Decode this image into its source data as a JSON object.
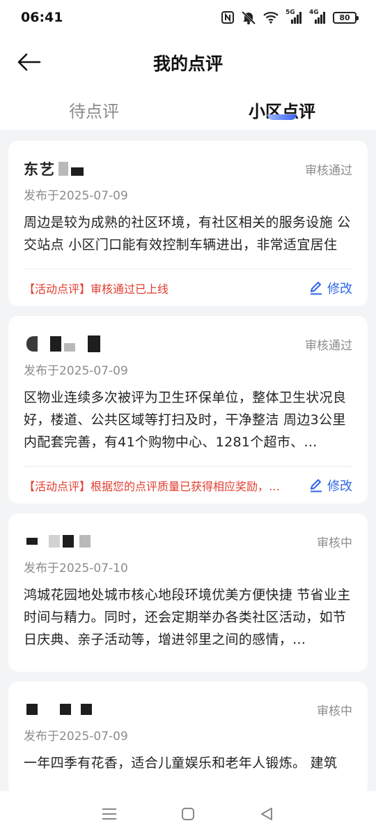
{
  "status_bar": {
    "time": "06:41",
    "battery": "80",
    "icons": [
      "nfc-icon",
      "mute-icon",
      "wifi-icon",
      "signal-5g-icon",
      "signal-4g-icon",
      "battery-icon"
    ],
    "signal_5g": "5G",
    "signal_4g": "4G"
  },
  "header": {
    "title": "我的点评",
    "back_icon": "back-arrow-icon"
  },
  "tabs": [
    {
      "label": "待点评",
      "active": false
    },
    {
      "label": "小区点评",
      "active": true
    }
  ],
  "colors": {
    "accent_blue": "#2f66e8",
    "alert_red": "#e03e2f",
    "muted_gray": "#8c8c8c"
  },
  "reviews": [
    {
      "author_visible": "东艺",
      "status": "审核通过",
      "date": "发布于2025-07-09",
      "content": "周边是较为成熟的社区环境，有社区相关的服务设施 公交站点 小区门口能有效控制车辆进出，非常适宜居住",
      "activity_note": "【活动点评】审核通过已上线",
      "edit_label": "修改"
    },
    {
      "author_visible": "",
      "status": "审核通过",
      "date": "发布于2025-07-09",
      "content": "区物业连续多次被评为卫生环保单位，整体卫生状况良好，楼道、公共区域等打扫及时，干净整洁 周边3公里内配套完善，有41个购物中心、1281个超市、…",
      "activity_note": "【活动点评】根据您的点评质量已获得相应奖励，…",
      "edit_label": "修改"
    },
    {
      "author_visible": "",
      "status": "审核中",
      "date": "发布于2025-07-10",
      "content": "鸿城花园地处城市核心地段环境优美方便快捷 节省业主时间与精力。同时，还会定期举办各类社区活动，如节日庆典、亲子活动等，增进邻里之间的感情，…"
    },
    {
      "author_visible": "",
      "status": "审核中",
      "date": "发布于2025-07-09",
      "content": "一年四季有花香，适合儿童娱乐和老年人锻炼。 建筑"
    }
  ],
  "nav_bar": {
    "icons": [
      "menu-icon",
      "home-icon",
      "back-triangle-icon"
    ]
  }
}
